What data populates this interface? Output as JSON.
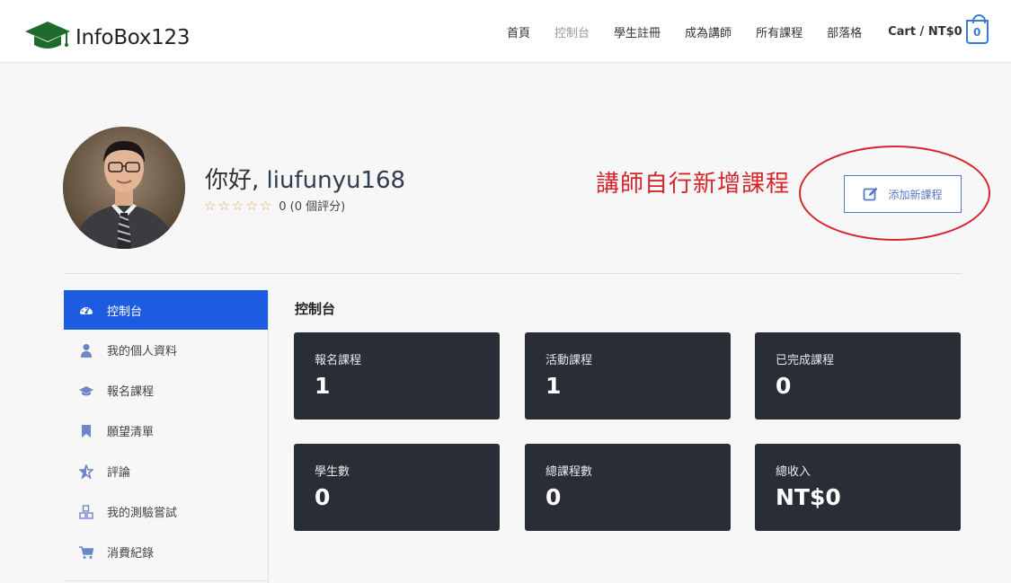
{
  "header": {
    "logo_text": "InfoBox123",
    "nav": [
      "首頁",
      "控制台",
      "學生註冊",
      "成為講師",
      "所有課程",
      "部落格"
    ],
    "active_nav": "控制台",
    "cart_label": "Cart / NT$0",
    "cart_count": "0"
  },
  "profile": {
    "greeting_prefix": "你好, ",
    "username": "liufunyu168",
    "rating_text": "0 (0 個評分)",
    "stars": 0
  },
  "annotation": "講師自行新增課程",
  "add_course_label": "添加新課程",
  "sidebar": {
    "items": [
      {
        "label": "控制台",
        "icon": "dashboard-icon"
      },
      {
        "label": "我的個人資料",
        "icon": "user-icon"
      },
      {
        "label": "報名課程",
        "icon": "graduation-cap-icon"
      },
      {
        "label": "願望清單",
        "icon": "bookmark-icon"
      },
      {
        "label": "評論",
        "icon": "star-icon"
      },
      {
        "label": "我的測驗嘗試",
        "icon": "cubes-icon"
      },
      {
        "label": "消費紀錄",
        "icon": "cart-icon"
      }
    ]
  },
  "main": {
    "title": "控制台",
    "cards": [
      {
        "label": "報名課程",
        "value": "1"
      },
      {
        "label": "活動課程",
        "value": "1"
      },
      {
        "label": "已完成課程",
        "value": "0"
      },
      {
        "label": "學生數",
        "value": "0"
      },
      {
        "label": "總課程數",
        "value": "0"
      },
      {
        "label": "總收入",
        "value": "NT$0"
      }
    ]
  },
  "colors": {
    "accent": "#1d5ce0",
    "card_bg": "#292d36",
    "annotation": "#d6252b"
  }
}
